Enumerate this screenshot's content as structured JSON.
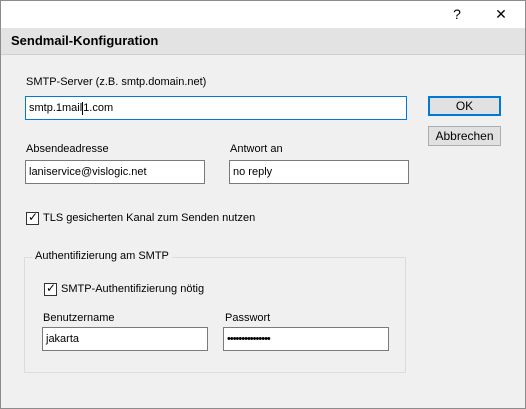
{
  "titlebar": {
    "help_glyph": "?",
    "close_glyph": "✕"
  },
  "header": {
    "title": "Sendmail-Konfiguration"
  },
  "smtp": {
    "label": "SMTP-Server (z.B. smtp.domain.net)",
    "value_before_caret": "smtp.1mail",
    "value_after_caret": "1.com"
  },
  "buttons": {
    "ok": "OK",
    "cancel": "Abbrechen"
  },
  "sender": {
    "label": "Absendeadresse",
    "value": "laniservice@vislogic.net"
  },
  "reply_to": {
    "label": "Antwort an",
    "value": "no reply"
  },
  "tls": {
    "label": "TLS gesicherten Kanal zum Senden nutzen",
    "checked": true
  },
  "auth_group": {
    "legend": "Authentifizierung am SMTP",
    "required_label": "SMTP-Authentifizierung nötig",
    "required_checked": true,
    "username_label": "Benutzername",
    "username_value": "jakarta",
    "password_label": "Passwort",
    "password_value": "•••••••••••••••"
  },
  "check_glyph": "✓"
}
